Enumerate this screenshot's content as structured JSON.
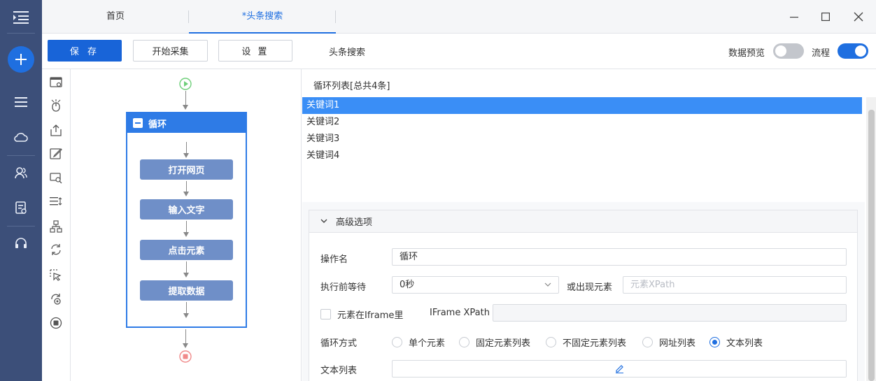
{
  "tabs": [
    {
      "label": "首页"
    },
    {
      "label": "*头条搜索"
    }
  ],
  "toolbar": {
    "save_label": "保 存",
    "collect_label": "开始采集",
    "settings_label": "设 置",
    "task_name": "头条搜索",
    "data_preview_label": "数据预览",
    "data_preview_on": false,
    "flow_label": "流程",
    "flow_on": true
  },
  "flow": {
    "loop_title": "循环",
    "steps": [
      {
        "label": "打开网页"
      },
      {
        "label": "输入文字"
      },
      {
        "label": "点击元素"
      },
      {
        "label": "提取数据"
      }
    ]
  },
  "loop_list": {
    "title": "循环列表[总共4条]",
    "items": [
      "关键词1",
      "关键词2",
      "关键词3",
      "关键词4"
    ],
    "selected_index": 0
  },
  "advanced": {
    "title": "高级选项",
    "op_name_label": "操作名",
    "op_name_value": "循环",
    "wait_label": "执行前等待",
    "wait_value": "0秒",
    "or_element_label": "或出现元素",
    "element_xpath_placeholder": "元素XPath",
    "iframe_checkbox_label": "元素在Iframe里",
    "iframe_checked": false,
    "iframe_xpath_label": "IFrame XPath",
    "loop_mode_label": "循环方式",
    "loop_modes": [
      "单个元素",
      "固定元素列表",
      "不固定元素列表",
      "网址列表",
      "文本列表"
    ],
    "loop_mode_selected": "文本列表",
    "text_list_label": "文本列表"
  },
  "colors": {
    "nav_bg": "#3c4f79",
    "accent": "#1f6fe0",
    "loop_header": "#2e7be6",
    "step_bg": "#6f8fc8",
    "selected_row": "#3a8ef6"
  }
}
